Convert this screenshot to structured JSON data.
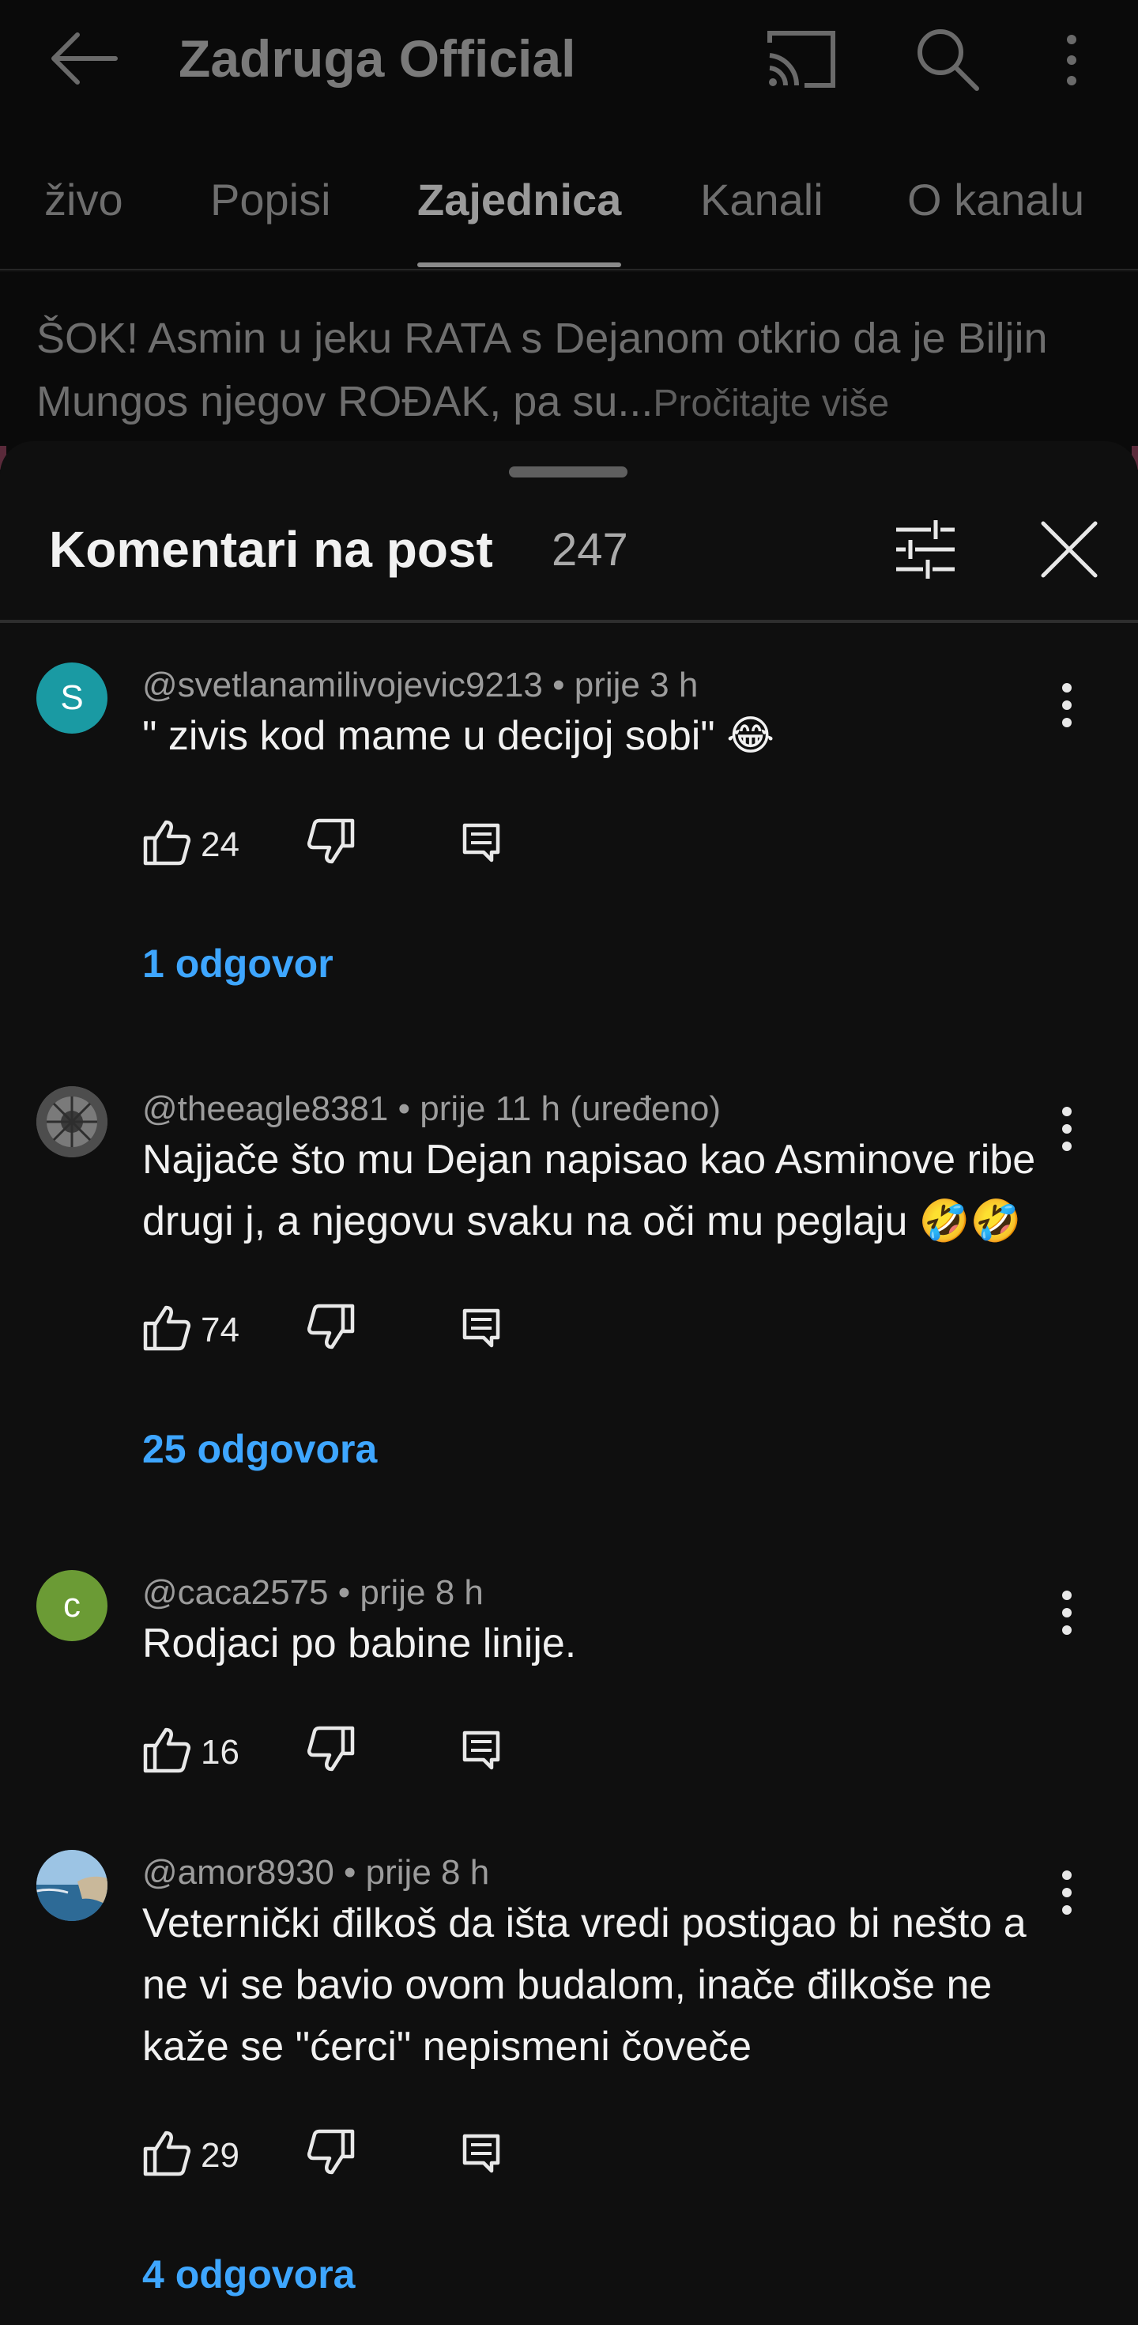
{
  "appbar": {
    "title": "Zadruga Official"
  },
  "tabs": [
    {
      "label": "živo"
    },
    {
      "label": "Popisi"
    },
    {
      "label": "Zajednica"
    },
    {
      "label": "Kanali"
    },
    {
      "label": "O kanalu"
    }
  ],
  "post_preview": {
    "text": "ŠOK! Asmin u jeku RATA s Dejanom otkrio da je Biljin Mungos njegov ROĐAK, pa su...",
    "read_more": "Pročitajte više"
  },
  "sheet": {
    "title": "Komentari na post",
    "count": "247"
  },
  "comments": [
    {
      "avatar_letter": "S",
      "avatar_color": "#1a9aa3",
      "meta": "@svetlanamilivojevic9213 • prije 3 h",
      "text": "\" zivis kod mame u decijoj sobi\" 😂",
      "likes": "24",
      "replies": "1 odgovor"
    },
    {
      "avatar_letter": "",
      "avatar_color": "#6b6b6b",
      "meta": "@theeagle8381 • prije 11 h (uređeno)",
      "text": "Najjače što mu Dejan napisao kao Asminove ribe drugi j, a njegovu svaku na oči mu peglaju 🤣🤣",
      "likes": "74",
      "replies": "25 odgovora"
    },
    {
      "avatar_letter": "c",
      "avatar_color": "#6b9b35",
      "meta": "@caca2575 • prije 8 h",
      "text": "Rodjaci po babine linije.",
      "likes": "16",
      "replies": ""
    },
    {
      "avatar_letter": "",
      "avatar_color": "#4a7fa8",
      "meta": "@amor8930 • prije 8 h",
      "text": "Veternički đilkoš da išta vredi postigao bi nešto a ne vi se bavio ovom budalom, inače đilkoše ne kaže se \"ćerci\" nepismeni čoveče",
      "likes": "29",
      "replies": "4 odgovora"
    }
  ]
}
